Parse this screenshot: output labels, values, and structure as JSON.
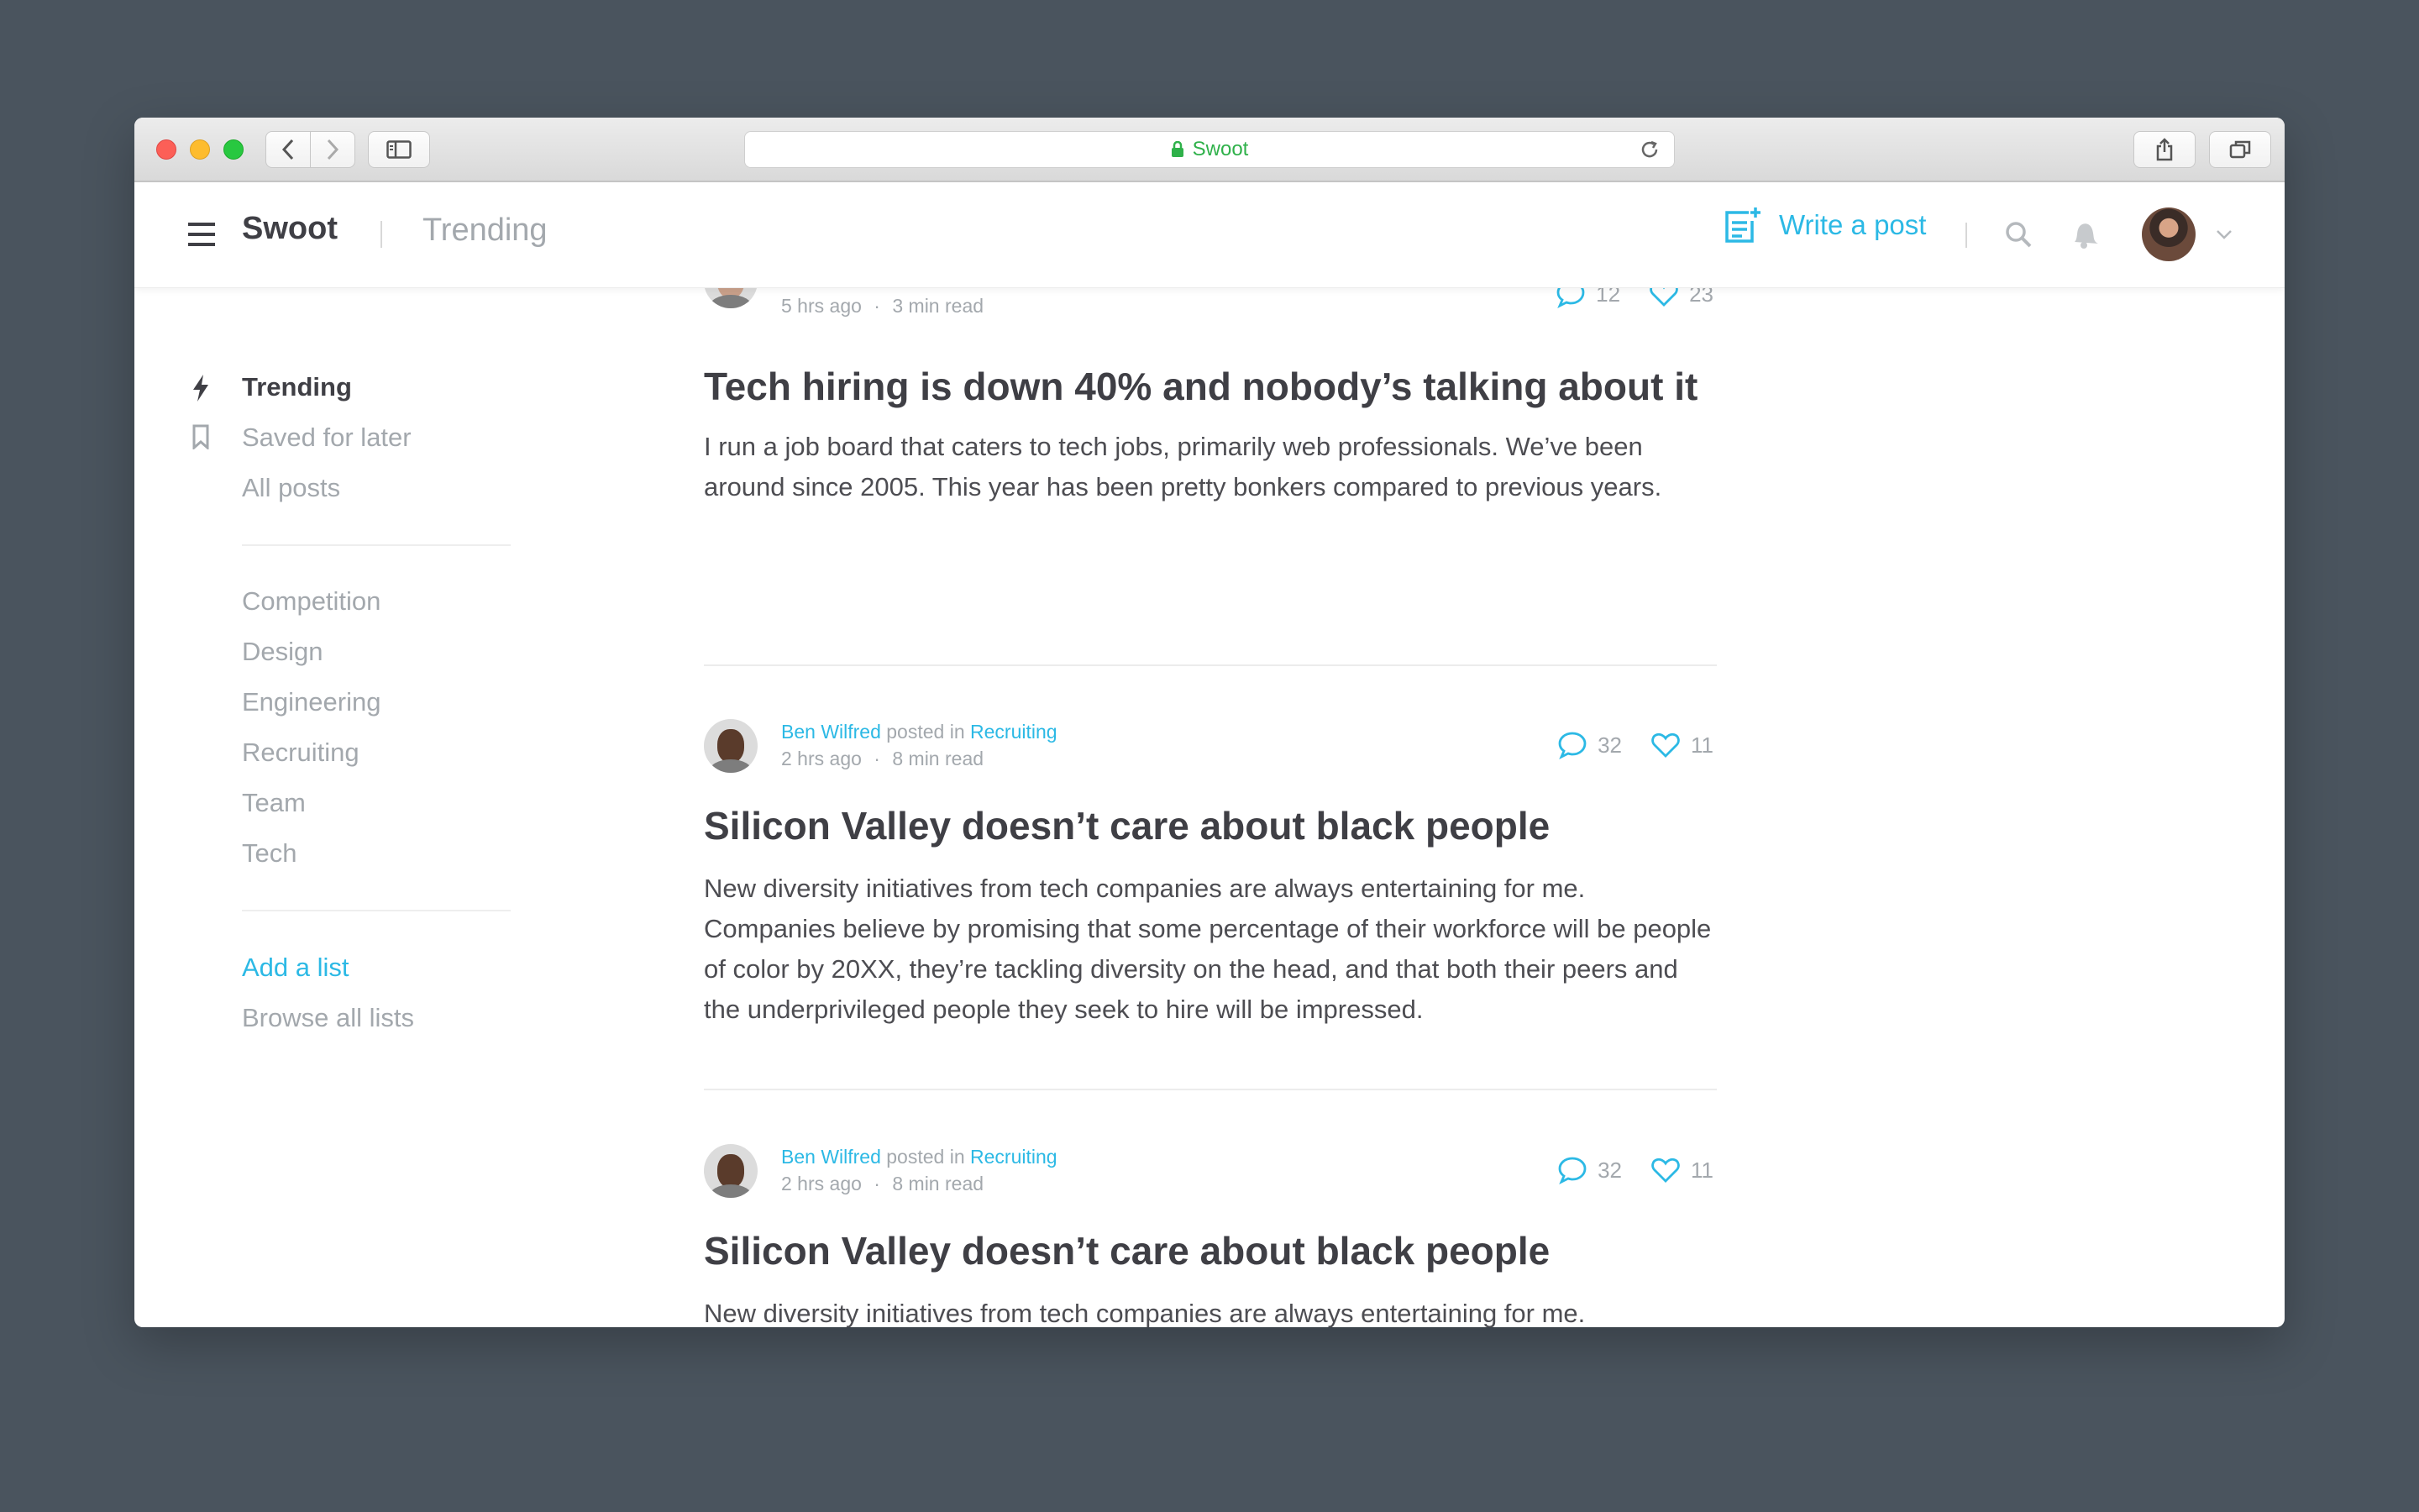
{
  "browser": {
    "url": "Swoot"
  },
  "header": {
    "brand": "Swoot",
    "section": "Trending",
    "write_post": "Write a post"
  },
  "sidebar": {
    "primary": [
      {
        "label": "Trending",
        "icon": "lightning-icon",
        "active": true
      },
      {
        "label": "Saved for later",
        "icon": "bookmark-icon"
      },
      {
        "label": "All posts"
      }
    ],
    "lists": [
      "Competition",
      "Design",
      "Engineering",
      "Recruiting",
      "Team",
      "Tech"
    ],
    "add_list": "Add a list",
    "browse_lists": "Browse all lists"
  },
  "posts": [
    {
      "time": "5 hrs ago",
      "read": "3 min read",
      "comments": "12",
      "likes": "23",
      "title": "Tech hiring is down 40% and nobody’s talking about it",
      "excerpt": "I run a job board that caters to tech jobs, primarily web professionals. We’ve been around since 2005. This year has been pretty bonkers compared to previous years."
    },
    {
      "author": "Ben Wilfred",
      "posted_in": "posted in",
      "category": "Recruiting",
      "time": "2 hrs ago",
      "read": "8 min read",
      "comments": "32",
      "likes": "11",
      "title": "Silicon Valley doesn’t care about black people",
      "excerpt": "New diversity initiatives from tech companies are always entertaining for me. Companies believe by promising that some percentage of their workforce will be people of color by 20XX, they’re tackling diversity on the head, and that both their peers and the underprivileged people they seek to hire will be impressed."
    },
    {
      "author": "Ben Wilfred",
      "posted_in": "posted in",
      "category": "Recruiting",
      "time": "2 hrs ago",
      "read": "8 min read",
      "comments": "32",
      "likes": "11",
      "title": "Silicon Valley doesn’t care about black people",
      "excerpt": "New diversity initiatives from tech companies are always entertaining for me. Companies believe by promising that some percentage of their workforce will be people of color by 20XX, they’re tackling diversity on the head, and that both their peers and the underprivileged people they seek to hire will be impressed."
    }
  ],
  "meta_separator": "·",
  "colors": {
    "accent": "#2cb9e5",
    "text_dark": "#3f3f45",
    "text_muted": "#a3a8ad",
    "backdrop": "#4a545e"
  }
}
